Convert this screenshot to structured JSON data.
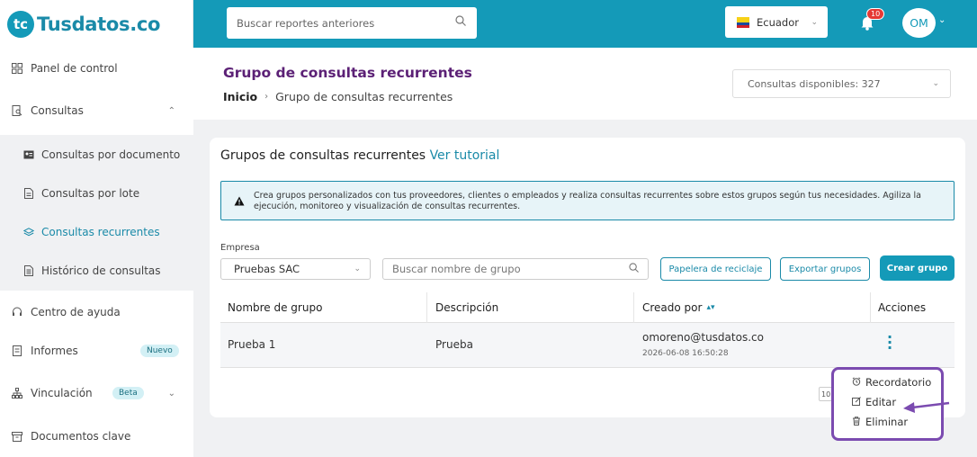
{
  "brand": {
    "logo_mark": "tc",
    "name": "Tusdatos.co"
  },
  "sidebar": {
    "items": [
      {
        "label": "Panel de control",
        "icon": "grid-icon"
      },
      {
        "label": "Consultas",
        "icon": "document-search-icon",
        "chevron": "⌃"
      },
      {
        "label": "Centro de ayuda",
        "icon": "headset-icon"
      },
      {
        "label": "Informes",
        "icon": "report-icon",
        "badge": "Nuevo"
      },
      {
        "label": "Vinculación",
        "icon": "hierarchy-icon",
        "badge": "Beta",
        "chevron": "⌄"
      },
      {
        "label": "Documentos clave",
        "icon": "archive-icon"
      }
    ],
    "sub_items": [
      {
        "label": "Consultas por documento",
        "icon": "id-card-icon"
      },
      {
        "label": "Consultas por lote",
        "icon": "file-icon"
      },
      {
        "label": "Consultas recurrentes",
        "icon": "layers-icon",
        "active": true
      },
      {
        "label": "Histórico de consultas",
        "icon": "file-list-icon"
      }
    ]
  },
  "topbar": {
    "search_placeholder": "Buscar reportes anteriores",
    "country": "Ecuador",
    "notifications": "10",
    "user_initials": "OM"
  },
  "header": {
    "title": "Grupo de consultas recurrentes",
    "breadcrumb_home": "Inicio",
    "breadcrumb_sep": "›",
    "breadcrumb_current": "Grupo de consultas recurrentes",
    "quota": "Consultas disponibles: 327"
  },
  "card": {
    "title": "Grupos de consultas recurrentes",
    "tutorial_link": "Ver tutorial",
    "info_text": "Crea grupos personalizados con tus proveedores, clientes o empleados y realiza consultas recurrentes sobre estos grupos según tus necesidades. Agiliza la ejecución, monitoreo y visualización de consultas recurrentes.",
    "empresa_label": "Empresa",
    "empresa_value": "Pruebas SAC",
    "search_placeholder": "Buscar nombre de grupo",
    "buttons": {
      "trash": "Papelera de reciclaje",
      "export": "Exportar grupos",
      "create": "Crear grupo"
    },
    "table": {
      "headers": [
        "Nombre de grupo",
        "Descripción",
        "Creado por",
        "Acciones"
      ],
      "rows": [
        {
          "name": "Prueba 1",
          "description": "Prueba",
          "created_by": "omoreno@tusdatos.co",
          "created_at": "2026-06-08 16:50:28"
        }
      ]
    },
    "pagination_fragment": "10"
  },
  "menu": {
    "items": [
      {
        "label": "Recordatorio",
        "icon": "alarm-icon"
      },
      {
        "label": "Editar",
        "icon": "edit-icon"
      },
      {
        "label": "Eliminar",
        "icon": "trash-icon"
      }
    ]
  },
  "colors": {
    "brand": "#149ab8",
    "accent": "#7b4bb0",
    "title": "#5c2176"
  }
}
